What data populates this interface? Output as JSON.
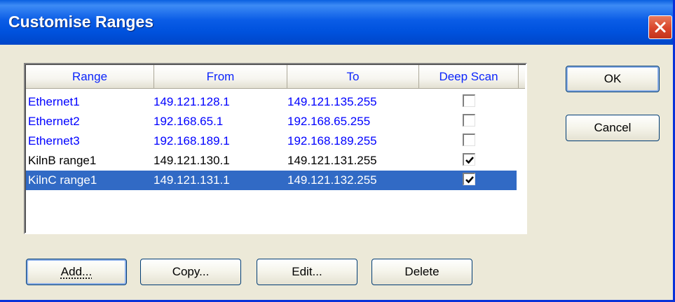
{
  "window": {
    "title": "Customise Ranges"
  },
  "list": {
    "columns": [
      {
        "label": "Range"
      },
      {
        "label": "From"
      },
      {
        "label": "To"
      },
      {
        "label": "Deep Scan"
      }
    ],
    "rows": [
      {
        "range": "Ethernet1",
        "from": "149.121.128.1",
        "to": "149.121.135.255",
        "deep_scan": false,
        "style": "blue"
      },
      {
        "range": "Ethernet2",
        "from": "192.168.65.1",
        "to": "192.168.65.255",
        "deep_scan": false,
        "style": "blue"
      },
      {
        "range": "Ethernet3",
        "from": "192.168.189.1",
        "to": "192.168.189.255",
        "deep_scan": false,
        "style": "blue"
      },
      {
        "range": "KilnB range1",
        "from": "149.121.130.1",
        "to": "149.121.131.255",
        "deep_scan": true,
        "style": "black"
      },
      {
        "range": "KilnC range1",
        "from": "149.121.131.1",
        "to": "149.121.132.255",
        "deep_scan": true,
        "style": "selected"
      }
    ]
  },
  "buttons": {
    "ok": "OK",
    "cancel": "Cancel",
    "add": "Add...",
    "copy": "Copy...",
    "edit": "Edit...",
    "delete": "Delete"
  },
  "colors": {
    "title_bar": "#0052de",
    "link_blue": "#0000ff",
    "selection": "#316ac5",
    "dialog_bg": "#ece9d8"
  },
  "icons": {
    "close": "close-icon",
    "check": "check-icon"
  }
}
